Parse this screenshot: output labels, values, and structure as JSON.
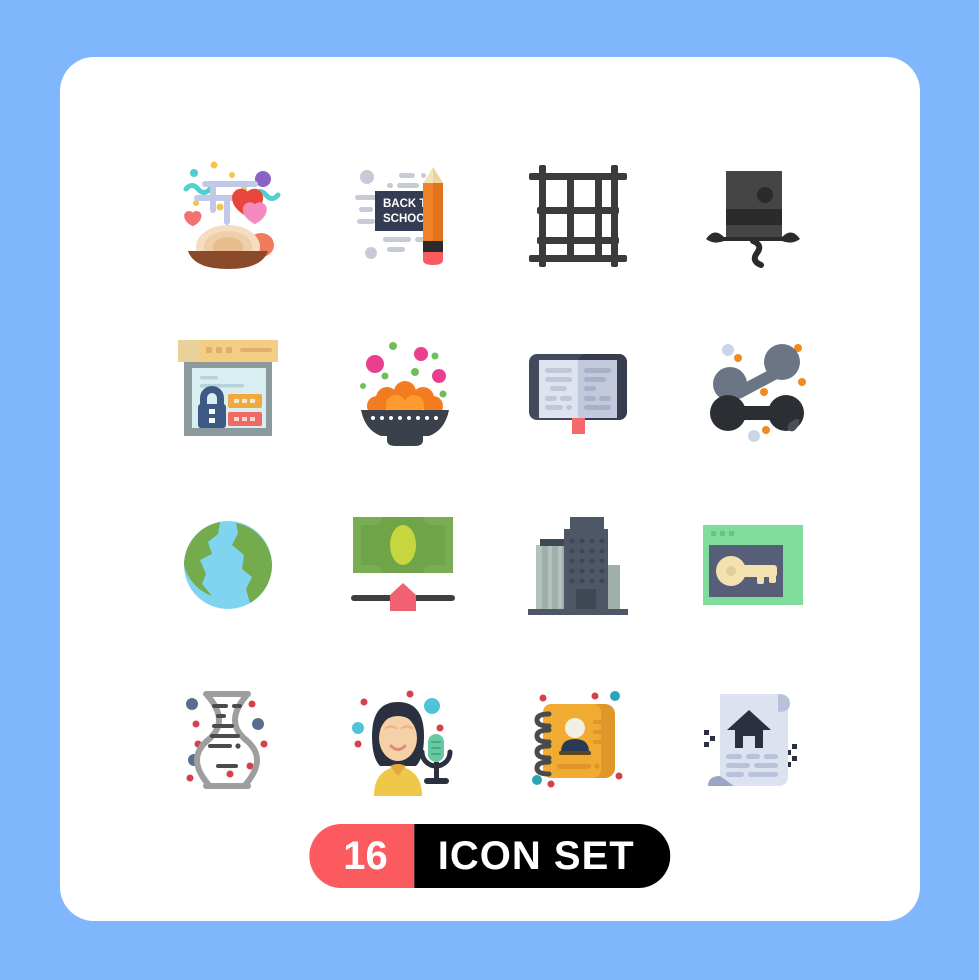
{
  "canvas": {
    "background_color": "#7fb6fc",
    "card_color": "#ffffff"
  },
  "footer": {
    "count": "16",
    "label": "ICON SET",
    "count_bg": "#fb5a5f",
    "label_bg": "#000000",
    "text_color": "#ffffff"
  },
  "icons": [
    {
      "name": "romantic-dinner-pasta-icon",
      "label": "Romantic Dinner Pasta",
      "row": 1,
      "col": 1,
      "colors": [
        "#8a4b2a",
        "#f6dcc0",
        "#e8543f",
        "#f48fb8",
        "#b9bce0"
      ]
    },
    {
      "name": "back-to-school-pencil-icon",
      "label": "Back To School Pencil",
      "row": 1,
      "col": 2,
      "banner_line1": "BACK TO",
      "banner_line2": "SCHOOL",
      "colors": [
        "#333c52",
        "#ef8228",
        "#f9e2b4",
        "#fb5a5f"
      ]
    },
    {
      "name": "scaffolding-grid-icon",
      "label": "Scaffolding Grid",
      "row": 1,
      "col": 3,
      "colors": [
        "#3b3b3b"
      ]
    },
    {
      "name": "top-hat-mustache-icon",
      "label": "Top Hat Mustache",
      "row": 1,
      "col": 4,
      "colors": [
        "#454545",
        "#2b2b2b"
      ]
    },
    {
      "name": "web-security-lock-icon",
      "label": "Web Security Lock",
      "row": 2,
      "col": 1,
      "colors": [
        "#f3cd84",
        "#8c9a9e",
        "#d9eef0",
        "#3c5a85",
        "#f0a93c",
        "#ef6a62"
      ]
    },
    {
      "name": "sweets-bowl-icon",
      "label": "Sweets Bowl Laddoo",
      "row": 2,
      "col": 2,
      "colors": [
        "#3b414a",
        "#f47c20",
        "#ff9a2e",
        "#e8408f",
        "#6cbf5b"
      ]
    },
    {
      "name": "open-book-bookmark-icon",
      "label": "Open Book Bookmark",
      "row": 2,
      "col": 3,
      "colors": [
        "#434a5c",
        "#dfe3f0",
        "#c3c9dc",
        "#f4696b"
      ]
    },
    {
      "name": "share-network-icon",
      "label": "Share Network Nodes",
      "row": 2,
      "col": 4,
      "colors": [
        "#2b2f33",
        "#6b7585",
        "#f08a1e",
        "#c9d6e8"
      ]
    },
    {
      "name": "globe-earth-icon",
      "label": "Globe Earth",
      "row": 3,
      "col": 1,
      "colors": [
        "#7fd4f0",
        "#74ab4d"
      ]
    },
    {
      "name": "money-budget-slider-icon",
      "label": "Money Budget Slider",
      "row": 3,
      "col": 2,
      "colors": [
        "#79ad52",
        "#c5d63f",
        "#3f3f3f",
        "#f06272"
      ]
    },
    {
      "name": "office-building-icon",
      "label": "Office Building",
      "row": 3,
      "col": 3,
      "colors": [
        "#4d5766",
        "#9fb0ac",
        "#3e4754"
      ]
    },
    {
      "name": "browser-key-access-icon",
      "label": "Browser Key Access",
      "row": 3,
      "col": 4,
      "colors": [
        "#7fdc9a",
        "#565e78",
        "#f3e2b0"
      ]
    },
    {
      "name": "dna-helix-icon",
      "label": "DNA Helix",
      "row": 4,
      "col": 1,
      "colors": [
        "#9e9e9e",
        "#4b4b4b",
        "#d4414a",
        "#5b6d8f"
      ]
    },
    {
      "name": "female-presenter-microphone-icon",
      "label": "Female Presenter Microphone",
      "row": 4,
      "col": 2,
      "colors": [
        "#2b3040",
        "#f6d1a8",
        "#efc84a",
        "#4fc3d8",
        "#67c9a0"
      ]
    },
    {
      "name": "address-book-contact-icon",
      "label": "Address Book Contact",
      "row": 4,
      "col": 3,
      "colors": [
        "#f0ab33",
        "#e0962a",
        "#4a4a4a",
        "#2b3a54"
      ]
    },
    {
      "name": "property-document-house-icon",
      "label": "Property Document House",
      "row": 4,
      "col": 4,
      "colors": [
        "#dde2f0",
        "#b9c2da",
        "#2b3040",
        "#9aa6c6"
      ]
    }
  ]
}
